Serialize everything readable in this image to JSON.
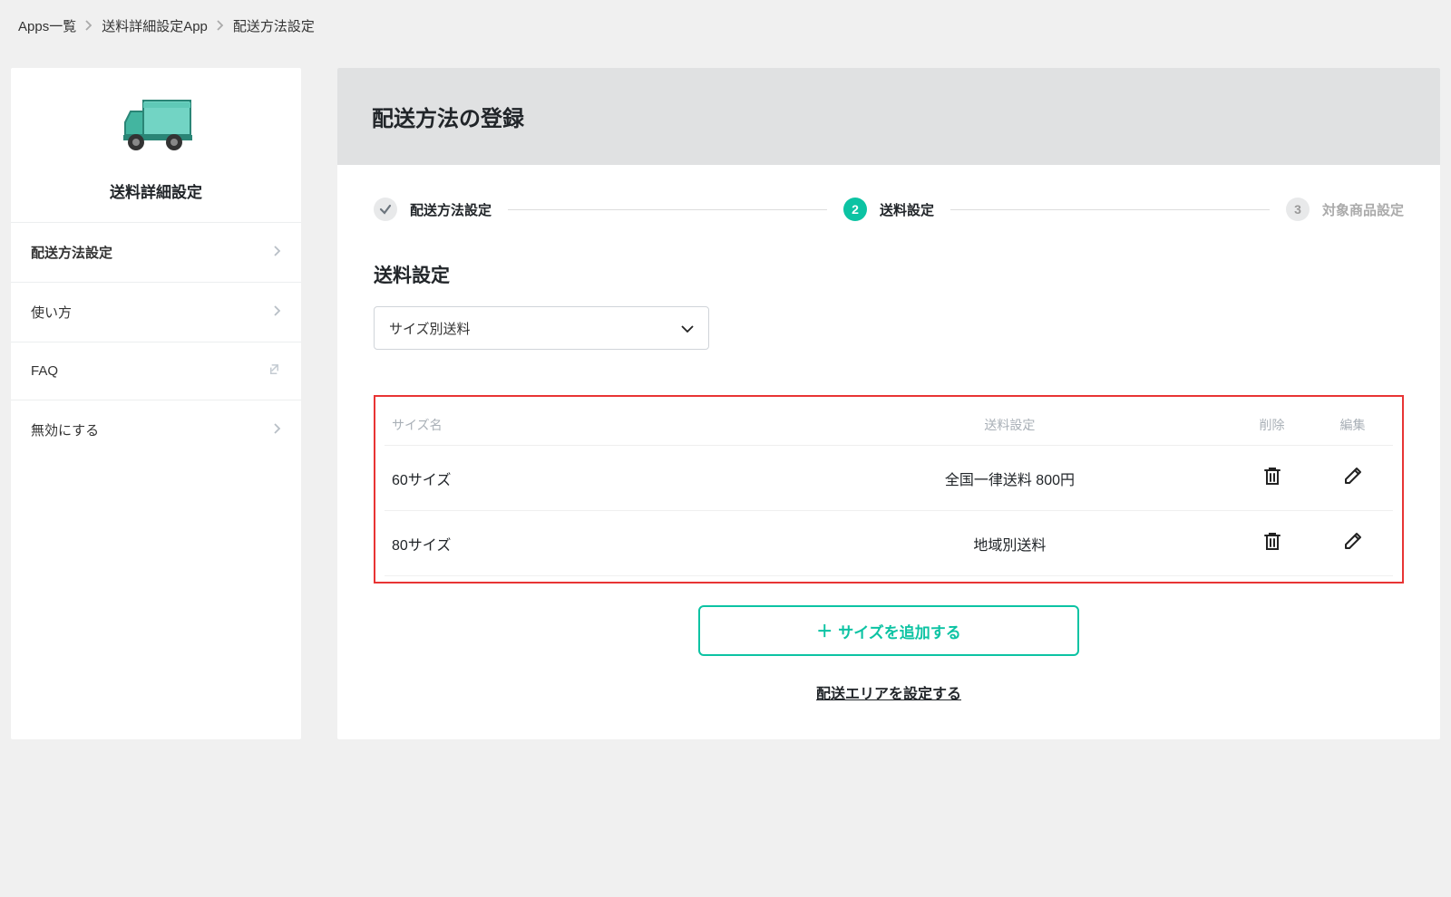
{
  "breadcrumb": {
    "items": [
      "Apps一覧",
      "送料詳細設定App",
      "配送方法設定"
    ]
  },
  "sidebar": {
    "title": "送料詳細設定",
    "items": [
      {
        "label": "配送方法設定",
        "active": true,
        "type": "chevron"
      },
      {
        "label": "使い方",
        "active": false,
        "type": "chevron"
      },
      {
        "label": "FAQ",
        "active": false,
        "type": "external"
      },
      {
        "label": "無効にする",
        "active": false,
        "type": "chevron"
      }
    ]
  },
  "main": {
    "title": "配送方法の登録",
    "stepper": {
      "steps": [
        {
          "label": "配送方法設定",
          "state": "done"
        },
        {
          "number": "2",
          "label": "送料設定",
          "state": "active"
        },
        {
          "number": "3",
          "label": "対象商品設定",
          "state": "pending"
        }
      ]
    },
    "section_title": "送料設定",
    "select_value": "サイズ別送料",
    "table": {
      "headers": {
        "size": "サイズ名",
        "fee": "送料設定",
        "delete": "削除",
        "edit": "編集"
      },
      "rows": [
        {
          "size": "60サイズ",
          "fee": "全国一律送料 800円"
        },
        {
          "size": "80サイズ",
          "fee": "地域別送料"
        }
      ]
    },
    "add_button": "サイズを追加する",
    "area_link": "配送エリアを設定する"
  }
}
